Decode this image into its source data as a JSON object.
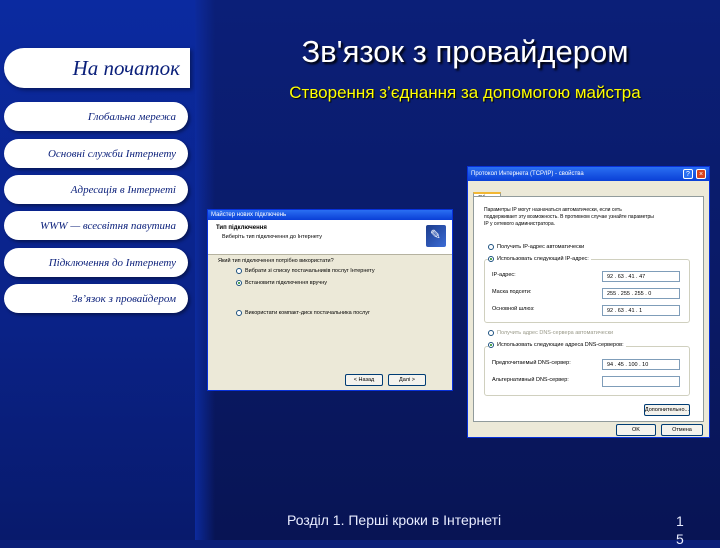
{
  "nav": {
    "home": "На початок",
    "items": [
      "Глобальна мережа",
      "Основні служби Інтернету",
      "Адресація в Інтернеті",
      "WWW — всесвітня павутина",
      "Підключення до Інтернету",
      "Зв’язок з провайдером"
    ]
  },
  "slide": {
    "title": "Зв'язок з провайдером",
    "subtitle": "Створення з’єднання за допомогою майстра",
    "footer": "Розділ 1. Перші кроки в Інтернеті",
    "page": "1 5"
  },
  "wizard": {
    "window_title": "Майстер нових підключень",
    "header_title": "Тип підключення",
    "header_text": "Виберіть тип підключення до Інтернету",
    "question": "Який тип підключення потрібно використати?",
    "options": [
      {
        "label": "Вибрати зі списку постачальників послуг Інтернету",
        "selected": false
      },
      {
        "label": "Встановити підключення вручну",
        "selected": true
      },
      {
        "label": "Використати компакт-диск постачальника послуг",
        "selected": false
      }
    ],
    "back_label": "< Назад",
    "next_label": "Далі >"
  },
  "tcpip": {
    "window_title": "Протокол Интернета (TCP/IP) - свойства",
    "tab": "Общие",
    "description": "Параметры IP могут назначаться автоматически, если сеть поддерживает эту возможность. В противном случае узнайте параметры IP у сетевого администратора.",
    "ip_auto": "Получить IP-адрес автоматически",
    "ip_manual": "Использовать следующий IP-адрес:",
    "ip_label": "IP-адрес:",
    "ip_value": "92 . 63 . 41 . 47",
    "mask_label": "Маска подсети:",
    "mask_value": "255 . 255 . 255 . 0",
    "gateway_label": "Основной шлюз:",
    "gateway_value": "92 . 63 . 41 . 1",
    "dns_auto": "Получить адрес DNS-сервера автоматически",
    "dns_manual": "Использовать следующие адреса DNS-серверов:",
    "dns1_label": "Предпочитаемый DNS-сервер:",
    "dns1_value": "94 . 45 . 100 . 10",
    "dns2_label": "Альтернативный DNS-сервер:",
    "advanced_label": "Дополнительно...",
    "ok_label": "OK",
    "cancel_label": "Отмена"
  }
}
